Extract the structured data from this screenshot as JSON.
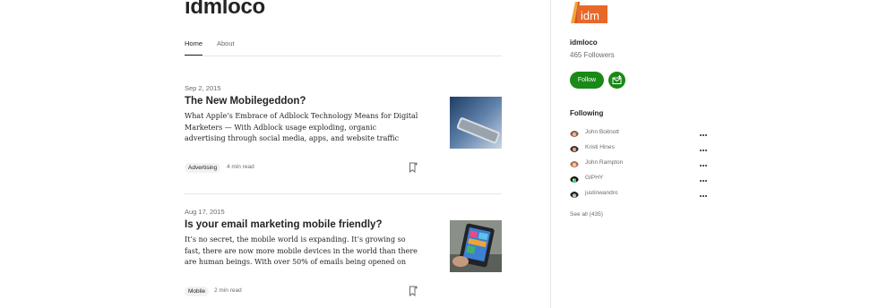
{
  "publication": {
    "title": "idmloco"
  },
  "tabs": [
    {
      "label": "Home"
    },
    {
      "label": "About"
    }
  ],
  "articles": [
    {
      "date": "Sep 2, 2015",
      "title": "The New Mobilegeddon?",
      "excerpt": "What Apple’s Embrace of Adblock Technology Means for Digital Marketers — With Adblock usage exploding, organic advertising through social media, apps, and website traffic holds the key to the…",
      "tag": "Advertising",
      "read_time": "4 min read",
      "thumbnail_icon": "phone-photo"
    },
    {
      "date": "Aug 17, 2015",
      "title": "Is your email marketing mobile friendly?",
      "excerpt": "It’s no secret, the mobile world is expanding. It’s growing so fast, there are now more mobile devices in the world than there are human beings. With over 50% of emails being opened on mobile devices, it i…",
      "tag": "Mobile",
      "read_time": "2 min read",
      "thumbnail_icon": "tablet-photo"
    }
  ],
  "sidebar": {
    "logo_text": "idm",
    "name": "idmloco",
    "followers": "465 Followers",
    "follow_label": "Follow",
    "following_heading": "Following",
    "following": [
      {
        "name": "John Boitnott"
      },
      {
        "name": "Kristi Hines"
      },
      {
        "name": "John Rampton"
      },
      {
        "name": "GIPHY"
      },
      {
        "name": "justinwandro"
      }
    ],
    "see_all": "See all (435)"
  },
  "colors": {
    "accent": "#1a8917",
    "logo_orange": "#e8682a",
    "text": "#242424",
    "muted": "#6b6b6b"
  }
}
